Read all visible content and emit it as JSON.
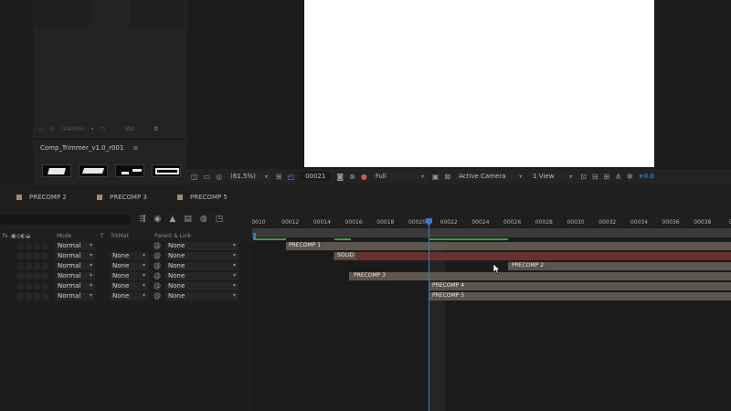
{
  "project_panel": {
    "toolbar": {
      "zoom": "(2400%)",
      "still": "Still"
    },
    "comp_name": "Comp_Trimmer_v1.0_r001"
  },
  "viewer": {
    "zoom": "(61.5%)",
    "timecode": "00021",
    "resolution": "Full",
    "camera": "Active Camera",
    "views": "1 View",
    "exposure": "+0.0"
  },
  "tabs": [
    {
      "label": "PRECOMP 2",
      "color": "#a8896c"
    },
    {
      "label": "PRECOMP 3",
      "color": "#a8896c"
    },
    {
      "label": "PRECOMP 5",
      "color": "#a8896c"
    }
  ],
  "ruler_ticks": [
    "0010",
    "00012",
    "00014",
    "00016",
    "00018",
    "00020",
    "00022",
    "00024",
    "00026",
    "00028",
    "00030",
    "00032",
    "00034",
    "00036",
    "00038",
    "000"
  ],
  "columns": {
    "fx": "fx",
    "mode": "Mode",
    "t": "T",
    "trkmat": "TrkMat",
    "parent": "Parent & Link"
  },
  "layers": [
    {
      "mode": "Normal",
      "trkmat": "",
      "parent": "None",
      "bar_label": "PRECOMP 1"
    },
    {
      "mode": "Normal",
      "trkmat": "None",
      "parent": "None",
      "bar_label": "SOLID"
    },
    {
      "mode": "Normal",
      "trkmat": "None",
      "parent": "None",
      "bar_label": "PRECOMP 2"
    },
    {
      "mode": "Normal",
      "trkmat": "None",
      "parent": "None",
      "bar_label": "PRECOMP 3"
    },
    {
      "mode": "Normal",
      "trkmat": "None",
      "parent": "None",
      "bar_label": "PRECOMP 4"
    },
    {
      "mode": "Normal",
      "trkmat": "None",
      "parent": "None",
      "bar_label": "PRECOMP 5"
    }
  ],
  "colors": {
    "playhead": "#3d79c9",
    "precomp": "#5d574f",
    "solid": "#6a2f2f",
    "label_tag": "#a8896c"
  }
}
